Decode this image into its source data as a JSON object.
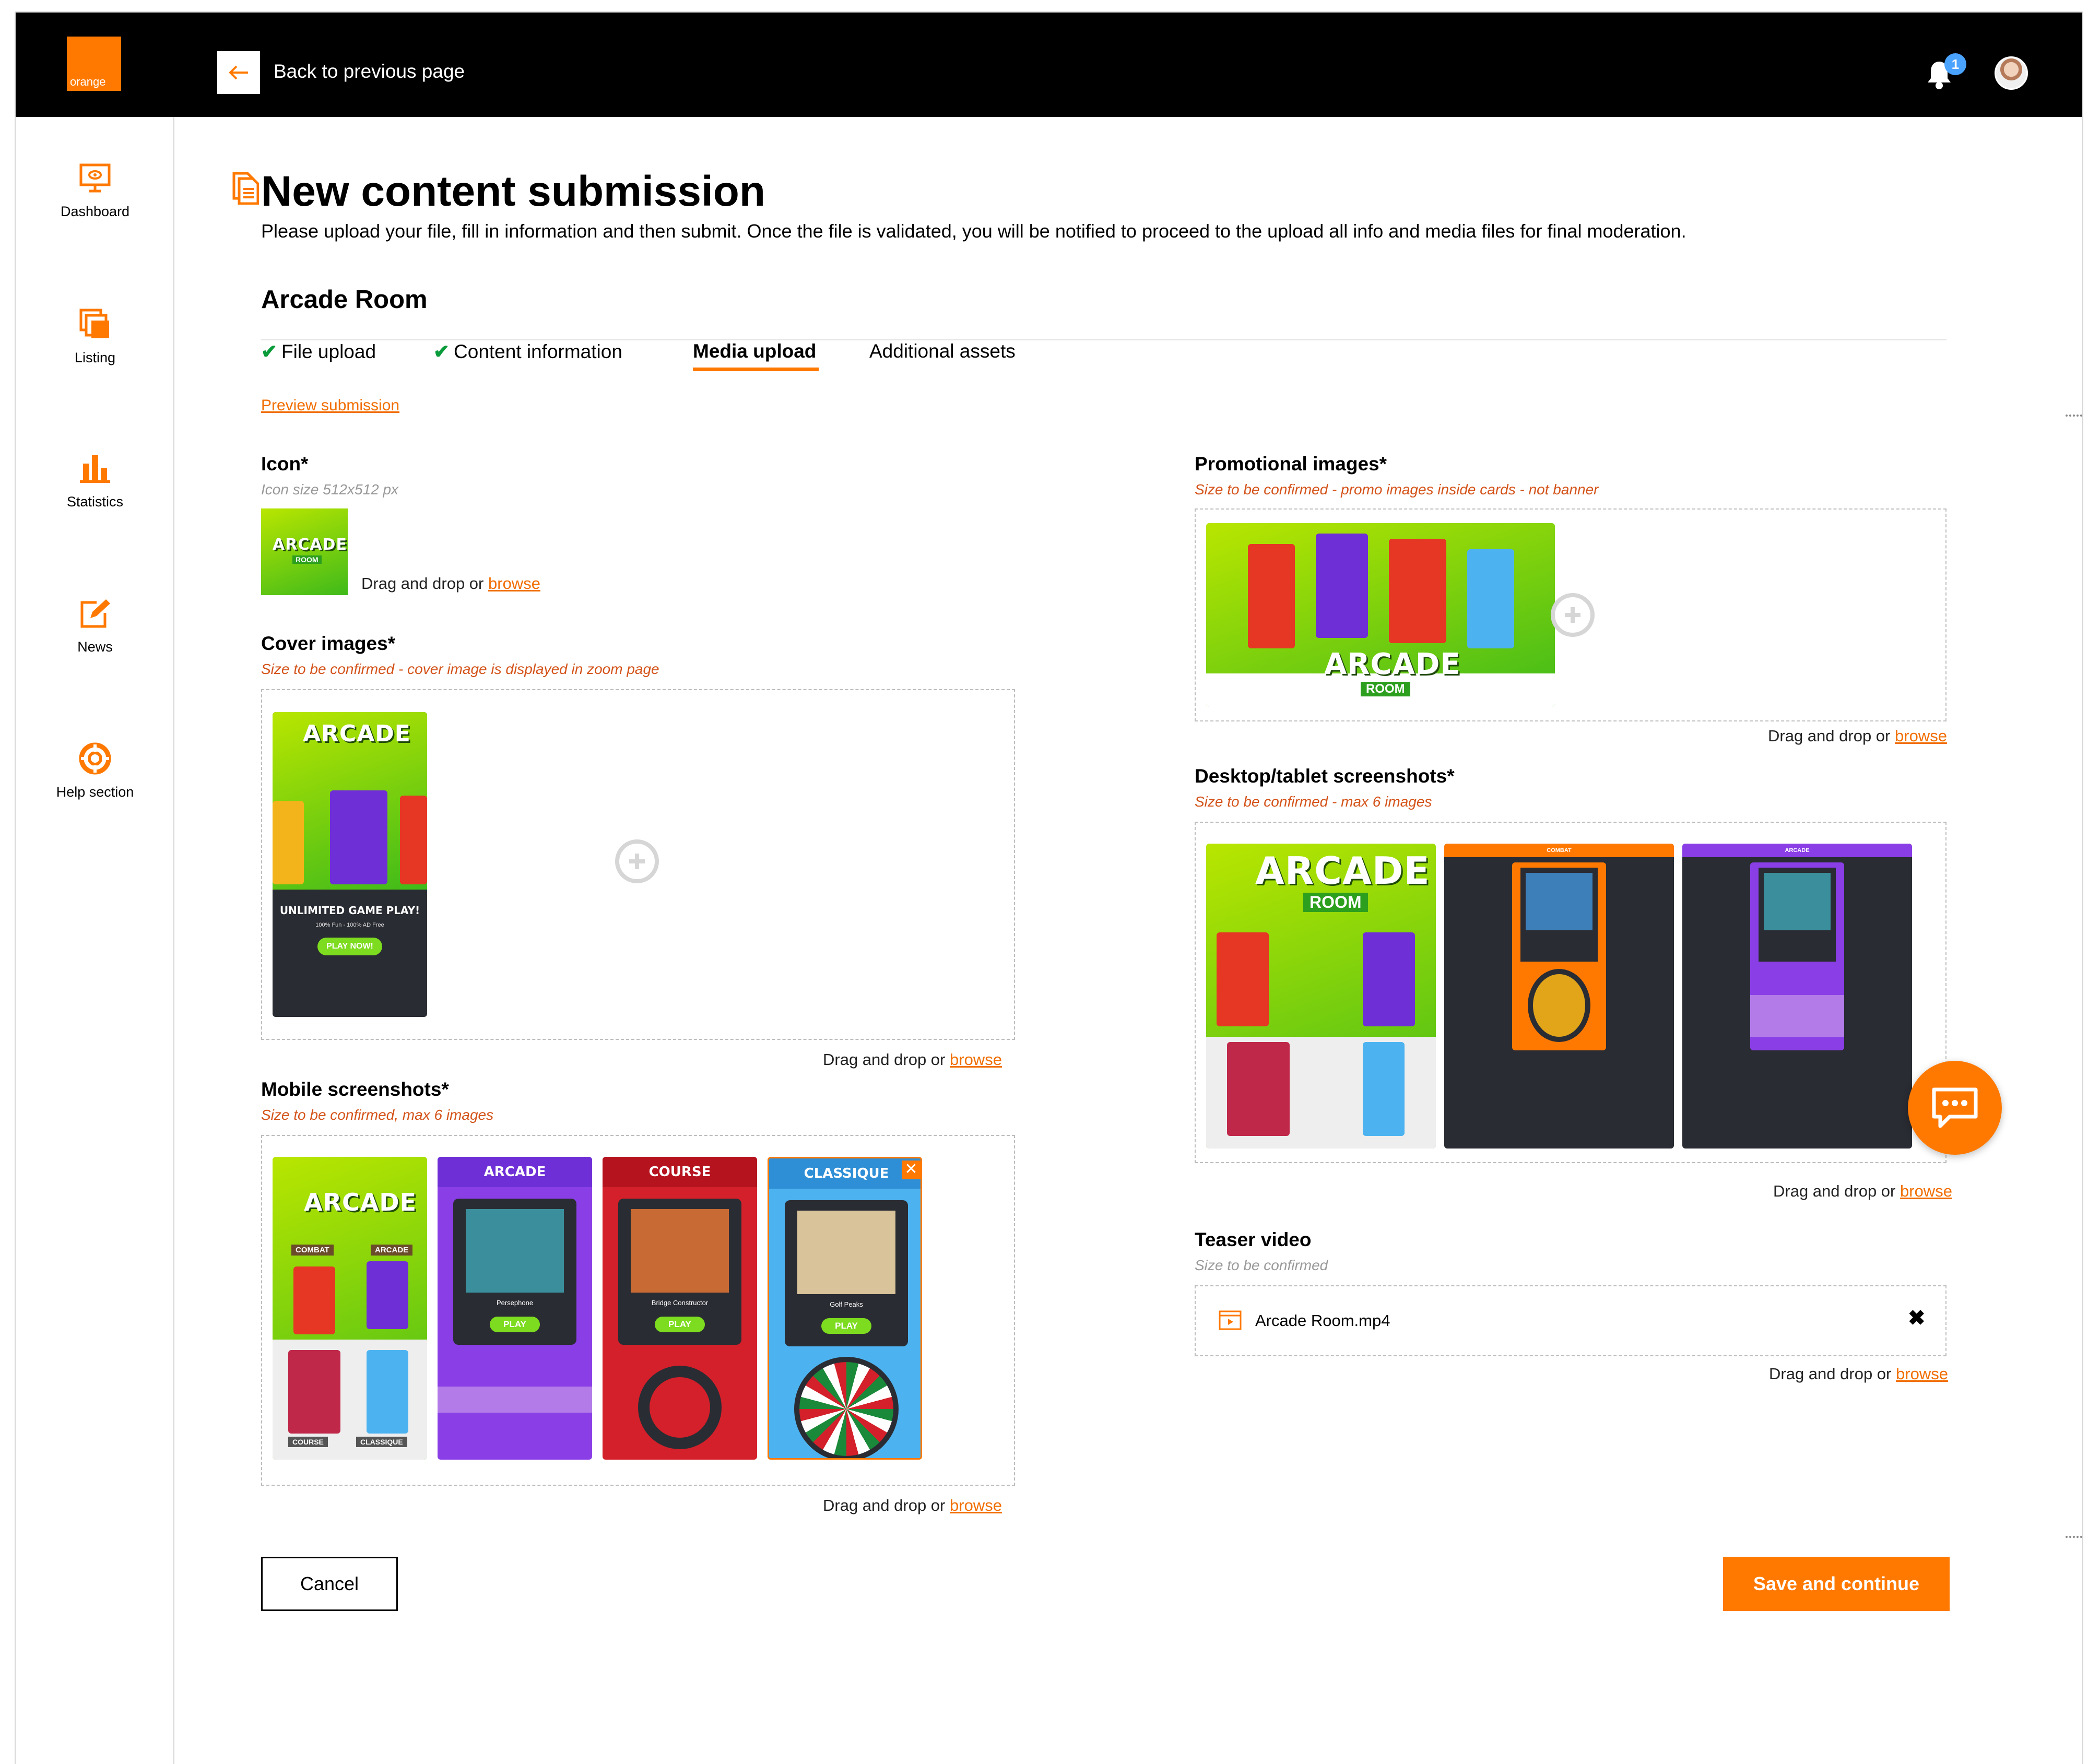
{
  "header": {
    "logo_text": "orange",
    "back_label": "Back to previous page",
    "notification_count": "1"
  },
  "sidebar": {
    "items": [
      {
        "label": "Dashboard",
        "icon": "monitor-icon"
      },
      {
        "label": "Listing",
        "icon": "listing-icon"
      },
      {
        "label": "Statistics",
        "icon": "bar-chart-icon"
      },
      {
        "label": "News",
        "icon": "edit-icon"
      },
      {
        "label": "Help section",
        "icon": "lifebuoy-icon"
      }
    ]
  },
  "page": {
    "title": "New content submission",
    "description": "Please upload your file, fill in information and then submit. Once the file is validated, you will be notified to proceed to the upload all info and media files for final moderation.",
    "content_name": "Arcade Room",
    "tabs": [
      {
        "label": "File upload",
        "done": true
      },
      {
        "label": "Content information",
        "done": true
      },
      {
        "label": "Media upload",
        "active": true
      },
      {
        "label": "Additional assets"
      }
    ],
    "preview_link": "Preview submission"
  },
  "common": {
    "drag_text": "Drag and drop or",
    "browse": "browse"
  },
  "icon_section": {
    "label": "Icon*",
    "hint": "Icon size 512x512 px"
  },
  "cover": {
    "label": "Cover images*",
    "hint": "Size to be confirmed  - cover image is displayed in zoom page"
  },
  "mobile": {
    "label": "Mobile screenshots*",
    "hint": "Size to be confirmed, max 6 images"
  },
  "promo": {
    "label": "Promotional images*",
    "hint": "Size to be confirmed  - promo images inside cards - not banner"
  },
  "desktop": {
    "label": "Desktop/tablet screenshots*",
    "hint": "Size to be confirmed  - max 6 images"
  },
  "teaser": {
    "label": "Teaser video",
    "hint": "Size to be confirmed",
    "file_name": "Arcade Room.mp4"
  },
  "artwork": {
    "arcade": "ARCADE",
    "room": "ROOM",
    "unlimited": "UNLIMITED GAME PLAY!",
    "sub": "100% Fun - 100% AD Free",
    "play_now": "PLAY NOW!",
    "combat": "COMBAT",
    "course": "COURSE",
    "classique": "CLASSIQUE",
    "play": "PLAY",
    "persephone": "Persephone",
    "bridge": "Bridge Constructor",
    "golf": "Golf Peaks"
  },
  "actions": {
    "cancel": "Cancel",
    "save": "Save and continue"
  },
  "colors": {
    "accent": "#ff7900",
    "success": "#0a9b3a",
    "link": "#f16e00"
  }
}
